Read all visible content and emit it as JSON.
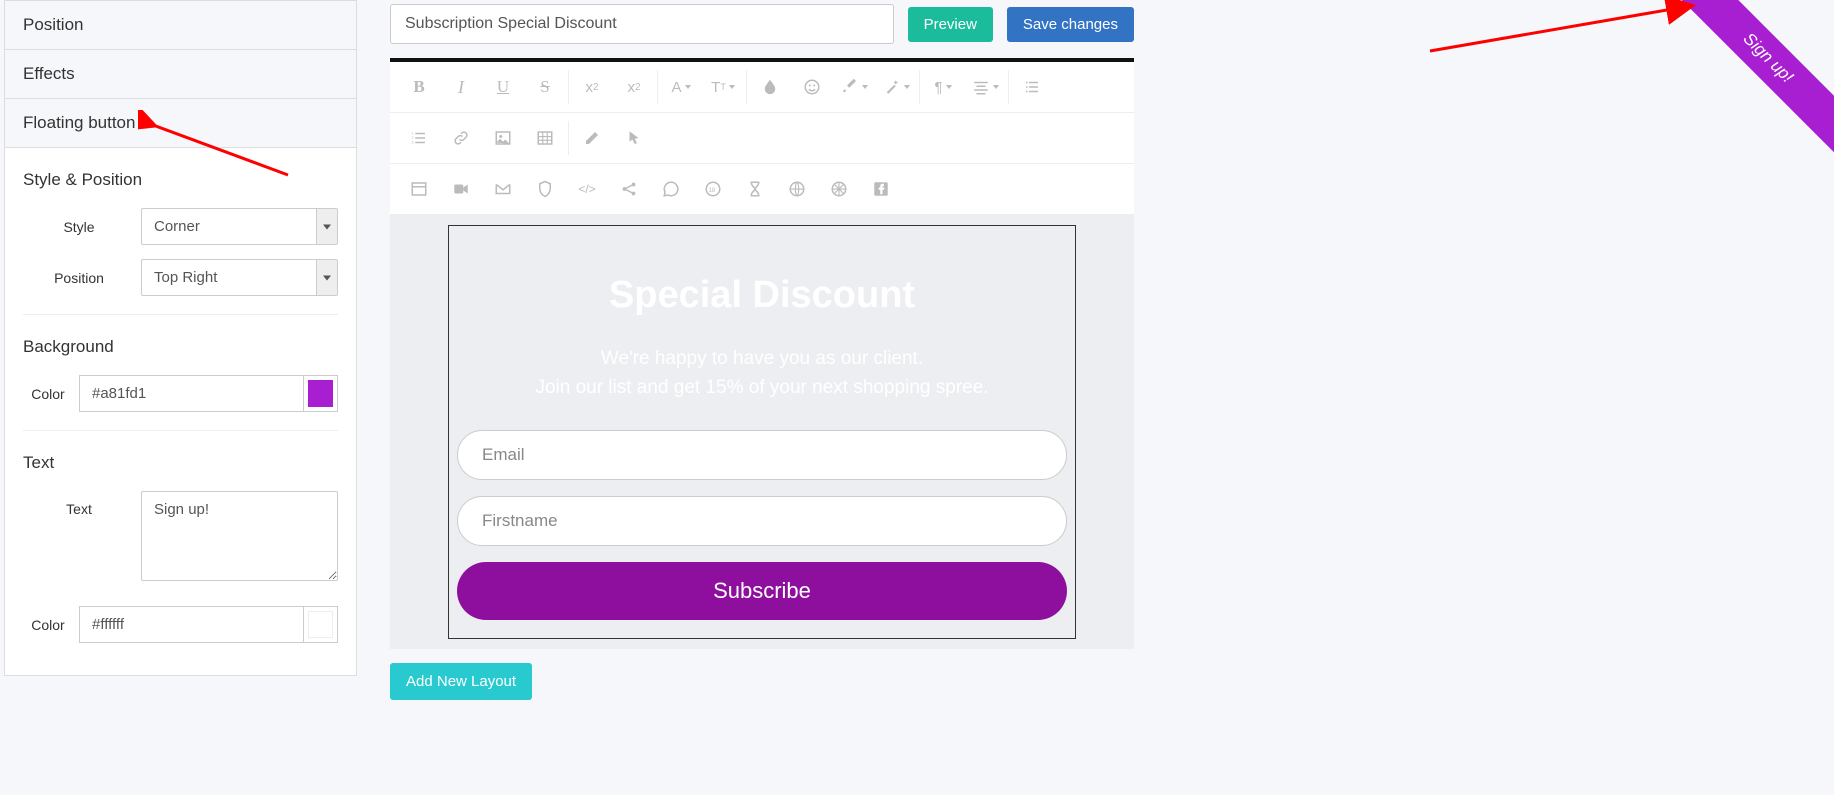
{
  "sidebar": {
    "accordion": {
      "position_label": "Position",
      "effects_label": "Effects",
      "floating_button_label": "Floating button"
    },
    "style_position": {
      "heading": "Style & Position",
      "style_label": "Style",
      "style_value": "Corner",
      "position_label": "Position",
      "position_value": "Top Right"
    },
    "background": {
      "heading": "Background",
      "color_label": "Color",
      "color_value": "#a81fd1"
    },
    "text": {
      "heading": "Text",
      "text_label": "Text",
      "text_value": "Sign up!",
      "color_label": "Color",
      "color_value": "#ffffff"
    }
  },
  "topbar": {
    "title_value": "Subscription Special Discount",
    "preview_label": "Preview",
    "save_label": "Save changes"
  },
  "canvas": {
    "popup": {
      "title": "Special Discount",
      "line1": "We're happy to have you as our client.",
      "line2": "Join our list and get 15% of your next shopping spree.",
      "email_placeholder": "Email",
      "firstname_placeholder": "Firstname",
      "subscribe_label": "Subscribe"
    },
    "add_layout_label": "Add New Layout"
  },
  "ribbon": {
    "label": "Sign up!"
  }
}
